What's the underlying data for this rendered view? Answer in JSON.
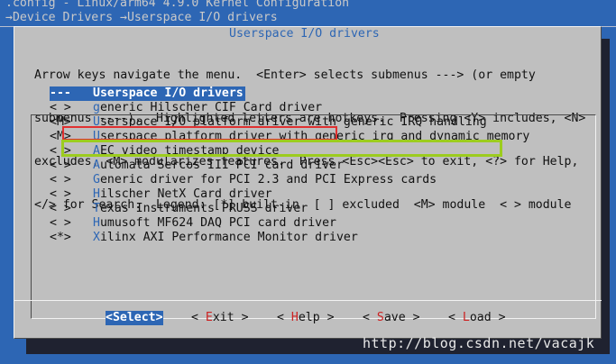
{
  "screen": {
    "config_line": ".config - Linux/arm64 4.9.0 Kernel Configuration",
    "breadcrumb_line": "→Device Drivers →Userspace I/O drivers"
  },
  "dialog": {
    "title": "Userspace I/O drivers",
    "help_lines": [
      "Arrow keys navigate the menu.  <Enter> selects submenus ---> (or empty",
      "submenus ----).  Highlighted letters are hotkeys.  Pressing <Y> includes, <N>",
      "excludes, <M> modularizes features.  Press <Esc><Esc> to exit, <?> for Help,",
      "</> for Search.  Legend: [*] built-in  [ ] excluded  <M> module  < > module"
    ],
    "menu": [
      {
        "mark": "--- ",
        "hot": "",
        "rest": "Userspace I/O drivers"
      },
      {
        "mark": "< > ",
        "hot": "g",
        "rest": "eneric Hilscher CIF Card driver"
      },
      {
        "mark": "<M> ",
        "hot": "U",
        "rest": "serspace I/O platform driver with generic IRQ handling"
      },
      {
        "mark": "<M> ",
        "hot": "U",
        "rest": "serspace platform driver with generic irq and dynamic memory"
      },
      {
        "mark": "< > ",
        "hot": "A",
        "rest": "EC video timestamp device"
      },
      {
        "mark": "< > ",
        "hot": "A",
        "rest": "utomata Sercos III PCI card driver"
      },
      {
        "mark": "< > ",
        "hot": "G",
        "rest": "eneric driver for PCI 2.3 and PCI Express cards"
      },
      {
        "mark": "< > ",
        "hot": "H",
        "rest": "ilscher NetX Card driver"
      },
      {
        "mark": "< > ",
        "hot": "T",
        "rest": "exas Instruments PRUSS driver"
      },
      {
        "mark": "< > ",
        "hot": "H",
        "rest": "umusoft MF624 DAQ PCI card driver"
      },
      {
        "mark": "<*> ",
        "hot": "X",
        "rest": "ilinx AXI Performance Monitor driver"
      }
    ],
    "buttons": {
      "select": {
        "pre": "<",
        "hot": "S",
        "rest": "elect>"
      },
      "exit": {
        "pre": "< ",
        "hot": "E",
        "rest": "xit >"
      },
      "help": {
        "pre": "< ",
        "hot": "H",
        "rest": "elp >"
      },
      "save": {
        "pre": "< ",
        "hot": "S",
        "rest": "ave >"
      },
      "load": {
        "pre": "< ",
        "hot": "L",
        "rest": "oad >"
      }
    }
  },
  "watermark": "http://blog.csdn.net/vacajk",
  "colors": {
    "background": "#2d66b4",
    "dialog": "#bfbfbf",
    "highlight_red": "#e03030",
    "highlight_green": "#9ccc1e"
  }
}
